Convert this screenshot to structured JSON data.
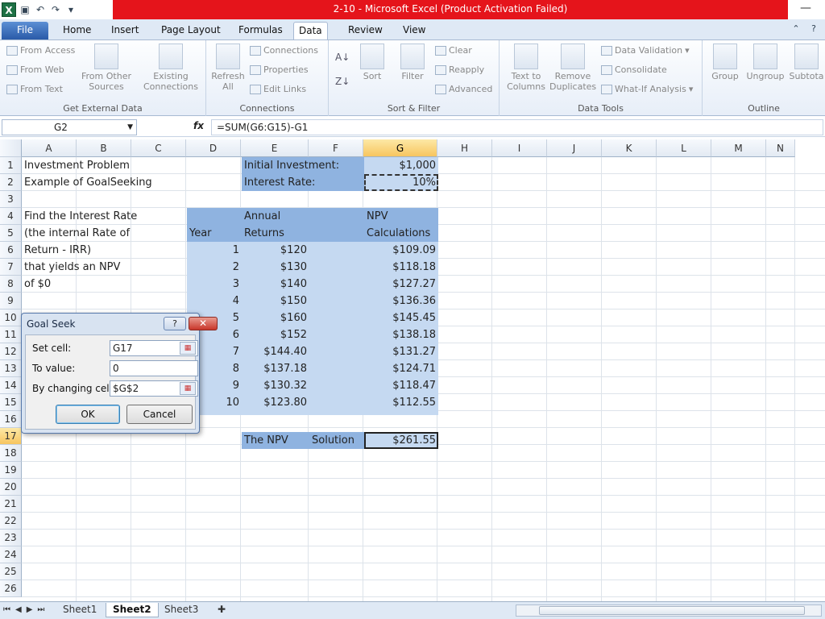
{
  "window": {
    "title": "2-10  -  Microsoft Excel (Product Activation Failed)"
  },
  "ribbon_tabs": [
    "File",
    "Home",
    "Insert",
    "Page Layout",
    "Formulas",
    "Data",
    "Review",
    "View"
  ],
  "active_tab": "Data",
  "ribbon": {
    "get_external": {
      "from_access": "From Access",
      "from_web": "From Web",
      "from_text": "From Text",
      "from_other": "From Other",
      "sources": "Sources",
      "existing": "Existing",
      "connections": "Connections",
      "label": "Get External Data"
    },
    "connections_grp": {
      "refresh": "Refresh",
      "all": "All",
      "connections": "Connections",
      "properties": "Properties",
      "edit_links": "Edit Links",
      "label": "Connections"
    },
    "sort_filter": {
      "sort": "Sort",
      "filter": "Filter",
      "clear": "Clear",
      "reapply": "Reapply",
      "advanced": "Advanced",
      "label": "Sort & Filter"
    },
    "data_tools": {
      "text_to": "Text to",
      "columns": "Columns",
      "remove": "Remove",
      "duplicates": "Duplicates",
      "data_validation": "Data Validation",
      "consolidate": "Consolidate",
      "what_if": "What-If Analysis",
      "label": "Data Tools"
    },
    "outline": {
      "group": "Group",
      "ungroup": "Ungroup",
      "subtotal": "Subtota",
      "label": "Outline"
    }
  },
  "formula_bar": {
    "name_box": "G2",
    "fx": "fx",
    "formula": "=SUM(G6:G15)-G1"
  },
  "columns": [
    "A",
    "B",
    "C",
    "D",
    "E",
    "F",
    "G",
    "H",
    "I",
    "J",
    "K",
    "L",
    "M",
    "N"
  ],
  "selected_column": "G",
  "rows": [
    "1",
    "2",
    "3",
    "4",
    "5",
    "6",
    "7",
    "8",
    "9",
    "10",
    "11",
    "12",
    "13",
    "14",
    "15",
    "16",
    "17",
    "18",
    "19",
    "20",
    "21",
    "22",
    "23",
    "24",
    "25",
    "26"
  ],
  "selected_row": "17",
  "cells": {
    "a1": "Investment Problem",
    "a2": "Example of GoalSeeking",
    "e1": "Initial Investment:",
    "g1": "$1,000",
    "e2": "Interest Rate:",
    "g2": "10%",
    "a4": "Find the Interest Rate",
    "a5": "(the internal Rate of",
    "a6": "Return - IRR)",
    "a7": "that yields an NPV",
    "a8": "of $0",
    "e4": "Annual",
    "e5": "Returns",
    "d5": "Year",
    "g4": "NPV",
    "g5": "Calculations",
    "e17": "The NPV",
    "f17": "Solution",
    "g17": "$261.55"
  },
  "table": {
    "years": [
      "1",
      "2",
      "3",
      "4",
      "5",
      "6",
      "7",
      "8",
      "9",
      "10"
    ],
    "returns": [
      "$120",
      "$130",
      "$140",
      "$150",
      "$160",
      "$152",
      "$144.40",
      "$137.18",
      "$130.32",
      "$123.80"
    ],
    "npv": [
      "$109.09",
      "$118.18",
      "$127.27",
      "$136.36",
      "$145.45",
      "$138.18",
      "$131.27",
      "$124.71",
      "$118.47",
      "$112.55"
    ]
  },
  "dialog": {
    "title": "Goal Seek",
    "help": "?",
    "close": "✕",
    "set_cell_label": "Set cell:",
    "set_cell_value": "G17",
    "to_value_label": "To value:",
    "to_value_value": "0",
    "changing_label": "By changing cell:",
    "changing_value": "$G$2",
    "ok": "OK",
    "cancel": "Cancel"
  },
  "sheets": [
    "Sheet1",
    "Sheet2",
    "Sheet3"
  ],
  "active_sheet": "Sheet2"
}
